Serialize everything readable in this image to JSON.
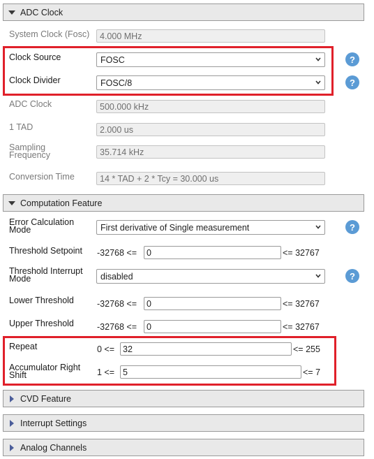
{
  "adc_clock": {
    "header": "ADC Clock",
    "system_clock": {
      "label": "System Clock (Fosc)",
      "value": "4.000 MHz"
    },
    "clock_source": {
      "label": "Clock Source",
      "value": "FOSC"
    },
    "clock_divider": {
      "label": "Clock Divider",
      "value": "FOSC/8"
    },
    "adc_clock": {
      "label": "ADC Clock",
      "value": "500.000 kHz"
    },
    "tad": {
      "label": "1 TAD",
      "value": "2.000 us"
    },
    "sampling_frequency": {
      "label": "Sampling Frequency",
      "value": "35.714 kHz"
    },
    "conversion_time": {
      "label": "Conversion Time",
      "value": "14 * TAD + 2 * Tcy = 30.000 us"
    }
  },
  "computation": {
    "header": "Computation Feature",
    "error_calc": {
      "label": "Error Calculation Mode",
      "value": "First derivative of Single measurement"
    },
    "threshold_setpoint": {
      "label": "Threshold Setpoint",
      "min": "-32768 <=",
      "value": "0",
      "max": "<= 32767"
    },
    "threshold_interrupt": {
      "label": "Threshold Interrupt Mode",
      "value": "disabled"
    },
    "lower_threshold": {
      "label": "Lower Threshold",
      "min": "-32768 <=",
      "value": "0",
      "max": "<= 32767"
    },
    "upper_threshold": {
      "label": "Upper Threshold",
      "min": "-32768 <=",
      "value": "0",
      "max": "<= 32767"
    },
    "repeat": {
      "label": "Repeat",
      "min": "0 <=",
      "value": "32",
      "max": "<= 255"
    },
    "acc_shift": {
      "label": "Accumulator Right Shift",
      "min": "1 <=",
      "value": "5",
      "max": "<= 7"
    }
  },
  "collapsed_sections": [
    "CVD Feature",
    "Interrupt Settings",
    "Analog Channels"
  ],
  "help_glyph": "?",
  "colors": {
    "accent": "#5b9bd5",
    "highlight": "#e0202a",
    "header_bg": "#e9e9e9"
  }
}
